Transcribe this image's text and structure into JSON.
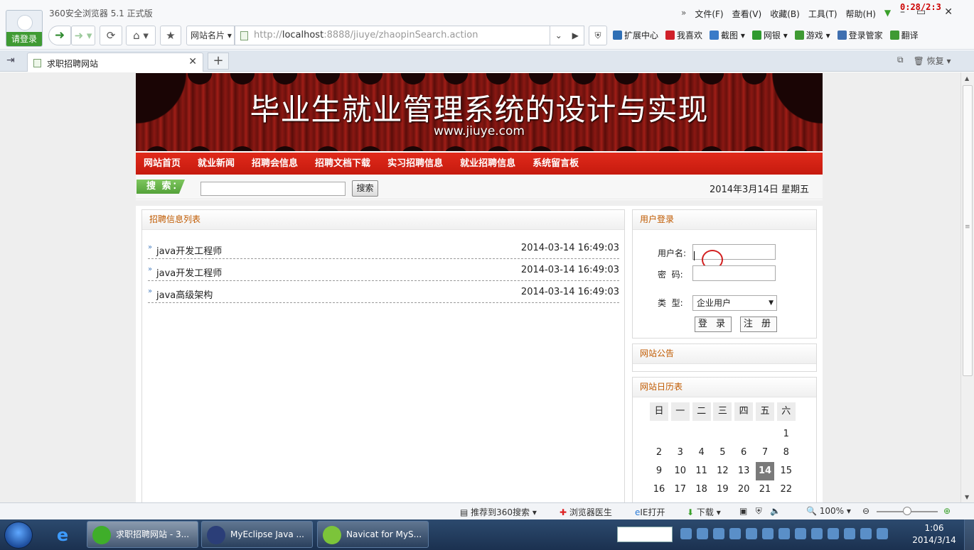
{
  "browser": {
    "login_label": "请登录",
    "app_title": "360安全浏览器 5.1 正式版",
    "timer": "0:28/2:3",
    "menu": [
      "文件(F)",
      "查看(V)",
      "收藏(B)",
      "工具(T)",
      "帮助(H)"
    ],
    "sitecard_label": "网站名片",
    "url_prefix": "http://",
    "url_host": "localhost",
    "url_rest": ":8888/jiuye/zhaopinSearch.action",
    "extensions": [
      {
        "label": "扩展中心",
        "icon": "box-icon",
        "color": "#2f6fb5"
      },
      {
        "label": "我喜欢",
        "icon": "heart-icon",
        "color": "#d0202a"
      },
      {
        "label": "截图",
        "icon": "screenshot-icon",
        "color": "#3a7bc8"
      },
      {
        "label": "网银",
        "icon": "bank-icon",
        "color": "#2f9a2f"
      },
      {
        "label": "游戏",
        "icon": "game-icon",
        "color": "#3f9a33"
      },
      {
        "label": "登录管家",
        "icon": "key-icon",
        "color": "#3f6fb0"
      },
      {
        "label": "翻译",
        "icon": "translate-icon",
        "color": "#3f9a33"
      }
    ],
    "tab_title": "求职招聘网站",
    "restore_label": "恢复"
  },
  "site": {
    "banner_title": "毕业生就业管理系统的设计与实现",
    "banner_url": "www.jiuye.com",
    "nav": [
      "网站首页",
      "就业新闻",
      "招聘会信息",
      "招聘文档下载",
      "实习招聘信息",
      "就业招聘信息",
      "系统留言板"
    ],
    "search_label": "搜 索：",
    "search_button": "搜索",
    "date": "2014年3月14日  星期五",
    "list_title": "招聘信息列表",
    "jobs": [
      {
        "name": "java开发工程师",
        "time": "2014-03-14 16:49:03"
      },
      {
        "name": "java开发工程师",
        "time": "2014-03-14 16:49:03"
      },
      {
        "name": "java高级架构",
        "time": "2014-03-14 16:49:03"
      }
    ],
    "login": {
      "title": "用户登录",
      "username_label": "用户名:",
      "password_label": "密  码:",
      "type_label": "类  型:",
      "type_value": "企业用户",
      "login_button": "登 录",
      "register_button": "注 册"
    },
    "notice_title": "网站公告",
    "calendar": {
      "title": "网站日历表",
      "weekdays": [
        "日",
        "一",
        "二",
        "三",
        "四",
        "五",
        "六"
      ],
      "rows": [
        [
          "",
          "",
          "",
          "",
          "",
          "",
          "1"
        ],
        [
          "2",
          "3",
          "4",
          "5",
          "6",
          "7",
          "8"
        ],
        [
          "9",
          "10",
          "11",
          "12",
          "13",
          "14",
          "15"
        ],
        [
          "16",
          "17",
          "18",
          "19",
          "20",
          "21",
          "22"
        ]
      ],
      "today": "14"
    }
  },
  "statusbar": {
    "recommend": "推荐到360搜索",
    "doctor": "浏览器医生",
    "ie_open": "IE打开",
    "download": "下载",
    "zoom": "100%"
  },
  "taskbar": {
    "tasks": [
      {
        "label": "求职招聘网站 - 3...",
        "color": "#3fae2a"
      },
      {
        "label": "MyEclipse Java ...",
        "color": "#2b3e78"
      },
      {
        "label": "Navicat for MyS...",
        "color": "#7cc43a"
      }
    ],
    "time": "1:06",
    "date": "2014/3/14"
  }
}
